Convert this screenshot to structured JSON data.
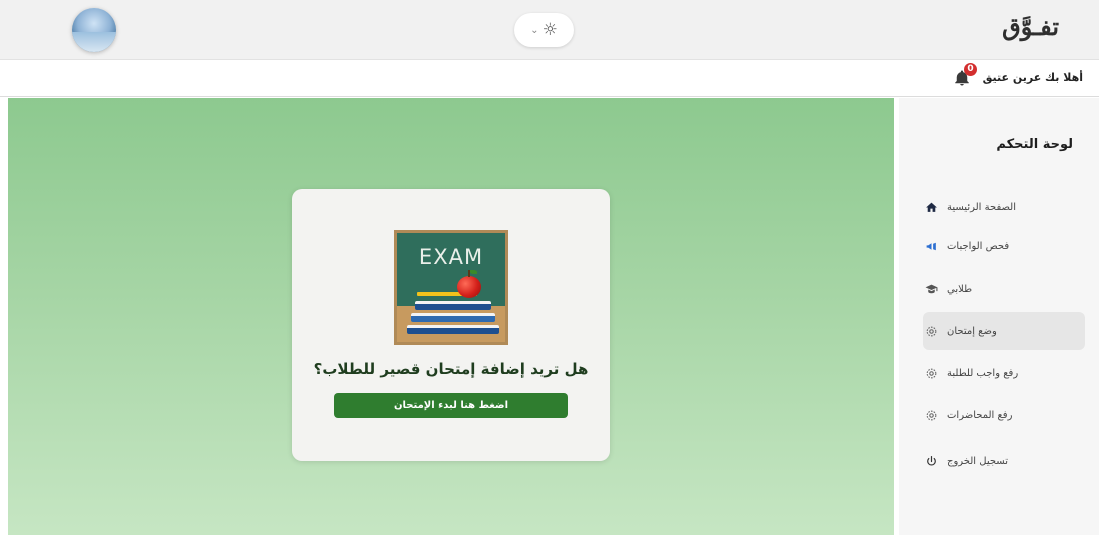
{
  "header": {
    "logo": "تفـوَّق",
    "theme_toggle": {
      "chevron": "⌄",
      "icon": "sun-icon",
      "glyph": "☼"
    }
  },
  "welcome_bar": {
    "greeting": "أهلا بك عرين عتيق",
    "notifications_count": "0"
  },
  "main": {
    "exam_image_text": "EXAM",
    "question": "هل تريد إضافة إمتحان قصير للطلاب؟",
    "start_button": "اضغط هنا لبدء الإمتحان"
  },
  "sidebar": {
    "title": "لوحة التحكم",
    "items": [
      {
        "label": "الصفحة الرئيسية",
        "icon": "home-icon"
      },
      {
        "label": "فحص الواجبات",
        "icon": "megaphone-icon"
      },
      {
        "label": "طلابي",
        "icon": "graduate-icon"
      },
      {
        "label": "وضع إمتحان",
        "icon": "gear-icon",
        "active": true
      },
      {
        "label": "رفع واجب للطلبة",
        "icon": "gear-icon"
      },
      {
        "label": "رفع المحاضرات",
        "icon": "gear-icon"
      },
      {
        "label": "تسجيل الخروج",
        "icon": "power-icon"
      }
    ]
  },
  "colors": {
    "accent_green": "#2f7d2f",
    "badge_red": "#d32f2f",
    "main_bg_top": "#8dc98f",
    "main_bg_bottom": "#c6e6c3"
  }
}
